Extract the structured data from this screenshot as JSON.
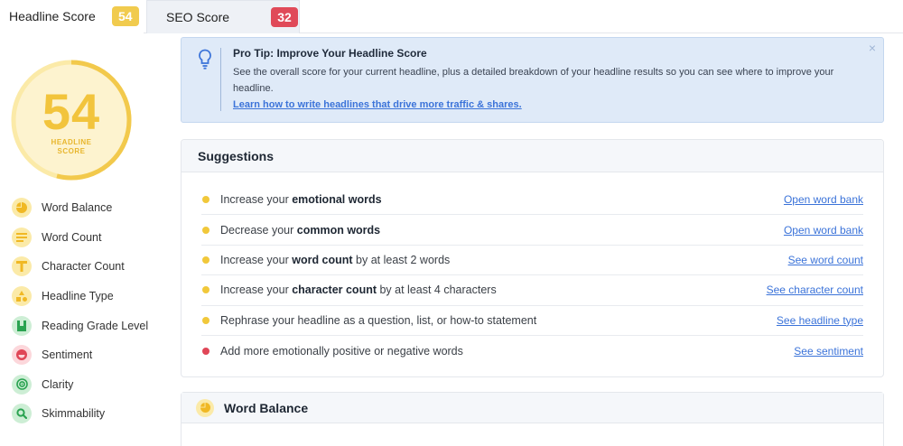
{
  "tabs": {
    "headline_label": "Headline Score",
    "headline_score": "54",
    "seo_label": "SEO Score",
    "seo_score": "32"
  },
  "score": {
    "value": "54",
    "fill_fraction": 0.54,
    "label_line1": "HEADLINE",
    "label_line2": "SCORE",
    "ring_color": "#f2c94c"
  },
  "sidebar": {
    "items": [
      {
        "label": "Word Balance",
        "icon": "pie-chart-icon",
        "color": "yellow"
      },
      {
        "label": "Word Count",
        "icon": "lines-icon",
        "color": "yellow"
      },
      {
        "label": "Character Count",
        "icon": "letter-t-icon",
        "color": "yellow"
      },
      {
        "label": "Headline Type",
        "icon": "shapes-icon",
        "color": "yellow"
      },
      {
        "label": "Reading Grade Level",
        "icon": "bookmark-icon",
        "color": "green"
      },
      {
        "label": "Sentiment",
        "icon": "smile-icon",
        "color": "red"
      },
      {
        "label": "Clarity",
        "icon": "target-icon",
        "color": "green"
      },
      {
        "label": "Skimmability",
        "icon": "magnifier-icon",
        "color": "green"
      }
    ]
  },
  "protip": {
    "title": "Pro Tip: Improve Your Headline Score",
    "text": "See the overall score for your current headline, plus a detailed breakdown of your headline results so you can see where to improve your headline.",
    "link": "Learn how to write headlines that drive more traffic & shares.",
    "close": "×"
  },
  "suggestions": {
    "title": "Suggestions",
    "rows": [
      {
        "pre": "Increase your ",
        "bold": "emotional words",
        "post": "",
        "link": "Open word bank",
        "status": "yellow"
      },
      {
        "pre": "Decrease your ",
        "bold": "common words",
        "post": "",
        "link": "Open word bank",
        "status": "yellow"
      },
      {
        "pre": "Increase your ",
        "bold": "word count",
        "post": " by at least 2 words",
        "link": "See word count",
        "status": "yellow"
      },
      {
        "pre": "Increase your ",
        "bold": "character count",
        "post": " by at least 4 characters",
        "link": "See character count",
        "status": "yellow"
      },
      {
        "pre": "Rephrase your headline as a question, list, or how-to statement",
        "bold": "",
        "post": "",
        "link": "See headline type",
        "status": "yellow"
      },
      {
        "pre": "Add more emotionally positive or negative words",
        "bold": "",
        "post": "",
        "link": "See sentiment",
        "status": "red"
      }
    ]
  },
  "word_balance": {
    "title": "Word Balance"
  }
}
